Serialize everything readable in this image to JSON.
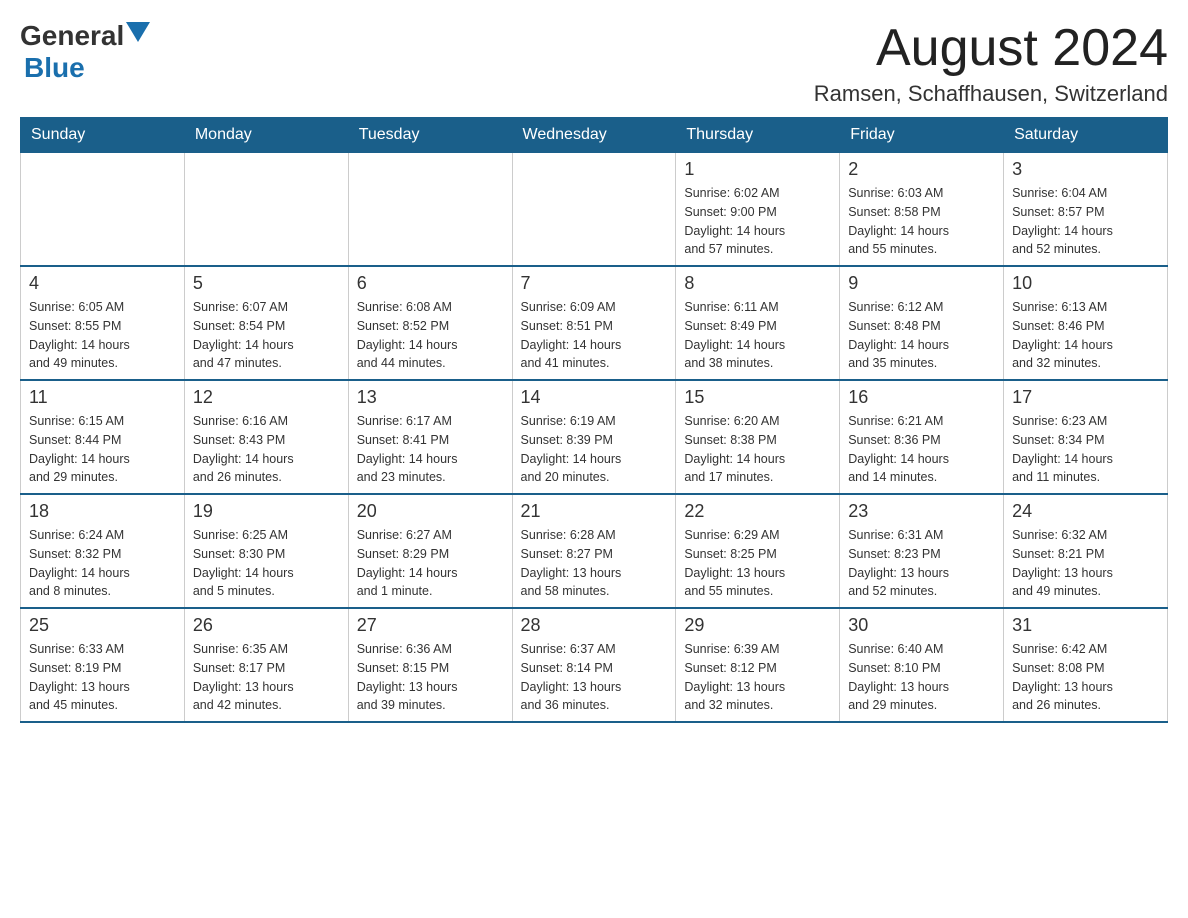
{
  "header": {
    "logo_general": "General",
    "logo_blue": "Blue",
    "month_year": "August 2024",
    "location": "Ramsen, Schaffhausen, Switzerland"
  },
  "weekdays": [
    "Sunday",
    "Monday",
    "Tuesday",
    "Wednesday",
    "Thursday",
    "Friday",
    "Saturday"
  ],
  "weeks": [
    [
      {
        "day": "",
        "info": ""
      },
      {
        "day": "",
        "info": ""
      },
      {
        "day": "",
        "info": ""
      },
      {
        "day": "",
        "info": ""
      },
      {
        "day": "1",
        "info": "Sunrise: 6:02 AM\nSunset: 9:00 PM\nDaylight: 14 hours\nand 57 minutes."
      },
      {
        "day": "2",
        "info": "Sunrise: 6:03 AM\nSunset: 8:58 PM\nDaylight: 14 hours\nand 55 minutes."
      },
      {
        "day": "3",
        "info": "Sunrise: 6:04 AM\nSunset: 8:57 PM\nDaylight: 14 hours\nand 52 minutes."
      }
    ],
    [
      {
        "day": "4",
        "info": "Sunrise: 6:05 AM\nSunset: 8:55 PM\nDaylight: 14 hours\nand 49 minutes."
      },
      {
        "day": "5",
        "info": "Sunrise: 6:07 AM\nSunset: 8:54 PM\nDaylight: 14 hours\nand 47 minutes."
      },
      {
        "day": "6",
        "info": "Sunrise: 6:08 AM\nSunset: 8:52 PM\nDaylight: 14 hours\nand 44 minutes."
      },
      {
        "day": "7",
        "info": "Sunrise: 6:09 AM\nSunset: 8:51 PM\nDaylight: 14 hours\nand 41 minutes."
      },
      {
        "day": "8",
        "info": "Sunrise: 6:11 AM\nSunset: 8:49 PM\nDaylight: 14 hours\nand 38 minutes."
      },
      {
        "day": "9",
        "info": "Sunrise: 6:12 AM\nSunset: 8:48 PM\nDaylight: 14 hours\nand 35 minutes."
      },
      {
        "day": "10",
        "info": "Sunrise: 6:13 AM\nSunset: 8:46 PM\nDaylight: 14 hours\nand 32 minutes."
      }
    ],
    [
      {
        "day": "11",
        "info": "Sunrise: 6:15 AM\nSunset: 8:44 PM\nDaylight: 14 hours\nand 29 minutes."
      },
      {
        "day": "12",
        "info": "Sunrise: 6:16 AM\nSunset: 8:43 PM\nDaylight: 14 hours\nand 26 minutes."
      },
      {
        "day": "13",
        "info": "Sunrise: 6:17 AM\nSunset: 8:41 PM\nDaylight: 14 hours\nand 23 minutes."
      },
      {
        "day": "14",
        "info": "Sunrise: 6:19 AM\nSunset: 8:39 PM\nDaylight: 14 hours\nand 20 minutes."
      },
      {
        "day": "15",
        "info": "Sunrise: 6:20 AM\nSunset: 8:38 PM\nDaylight: 14 hours\nand 17 minutes."
      },
      {
        "day": "16",
        "info": "Sunrise: 6:21 AM\nSunset: 8:36 PM\nDaylight: 14 hours\nand 14 minutes."
      },
      {
        "day": "17",
        "info": "Sunrise: 6:23 AM\nSunset: 8:34 PM\nDaylight: 14 hours\nand 11 minutes."
      }
    ],
    [
      {
        "day": "18",
        "info": "Sunrise: 6:24 AM\nSunset: 8:32 PM\nDaylight: 14 hours\nand 8 minutes."
      },
      {
        "day": "19",
        "info": "Sunrise: 6:25 AM\nSunset: 8:30 PM\nDaylight: 14 hours\nand 5 minutes."
      },
      {
        "day": "20",
        "info": "Sunrise: 6:27 AM\nSunset: 8:29 PM\nDaylight: 14 hours\nand 1 minute."
      },
      {
        "day": "21",
        "info": "Sunrise: 6:28 AM\nSunset: 8:27 PM\nDaylight: 13 hours\nand 58 minutes."
      },
      {
        "day": "22",
        "info": "Sunrise: 6:29 AM\nSunset: 8:25 PM\nDaylight: 13 hours\nand 55 minutes."
      },
      {
        "day": "23",
        "info": "Sunrise: 6:31 AM\nSunset: 8:23 PM\nDaylight: 13 hours\nand 52 minutes."
      },
      {
        "day": "24",
        "info": "Sunrise: 6:32 AM\nSunset: 8:21 PM\nDaylight: 13 hours\nand 49 minutes."
      }
    ],
    [
      {
        "day": "25",
        "info": "Sunrise: 6:33 AM\nSunset: 8:19 PM\nDaylight: 13 hours\nand 45 minutes."
      },
      {
        "day": "26",
        "info": "Sunrise: 6:35 AM\nSunset: 8:17 PM\nDaylight: 13 hours\nand 42 minutes."
      },
      {
        "day": "27",
        "info": "Sunrise: 6:36 AM\nSunset: 8:15 PM\nDaylight: 13 hours\nand 39 minutes."
      },
      {
        "day": "28",
        "info": "Sunrise: 6:37 AM\nSunset: 8:14 PM\nDaylight: 13 hours\nand 36 minutes."
      },
      {
        "day": "29",
        "info": "Sunrise: 6:39 AM\nSunset: 8:12 PM\nDaylight: 13 hours\nand 32 minutes."
      },
      {
        "day": "30",
        "info": "Sunrise: 6:40 AM\nSunset: 8:10 PM\nDaylight: 13 hours\nand 29 minutes."
      },
      {
        "day": "31",
        "info": "Sunrise: 6:42 AM\nSunset: 8:08 PM\nDaylight: 13 hours\nand 26 minutes."
      }
    ]
  ]
}
